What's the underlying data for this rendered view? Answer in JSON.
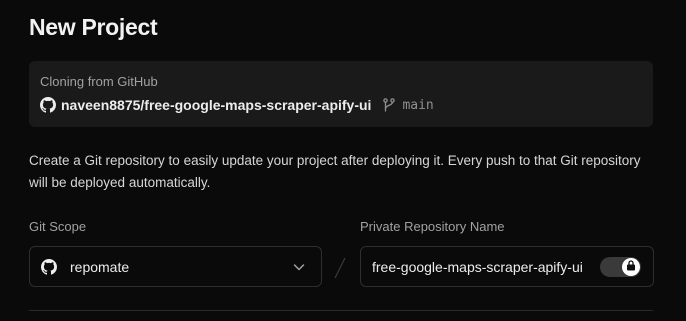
{
  "header": {
    "title": "New Project"
  },
  "clone": {
    "label": "Cloning from GitHub",
    "repo": "naveen8875/free-google-maps-scraper-apify-ui",
    "branch": "main",
    "repo_icon": "github-icon",
    "branch_icon": "git-branch-icon"
  },
  "description": "Create a Git repository to easily update your project after deploying it. Every push to that Git repository will be deployed automatically.",
  "git_scope": {
    "label": "Git Scope",
    "value": "repomate",
    "icon": "github-icon"
  },
  "repo_name": {
    "label": "Private Repository Name",
    "value": "free-google-maps-scraper-apify-ui",
    "private_toggle_on": true,
    "toggle_icon": "lock-icon"
  }
}
